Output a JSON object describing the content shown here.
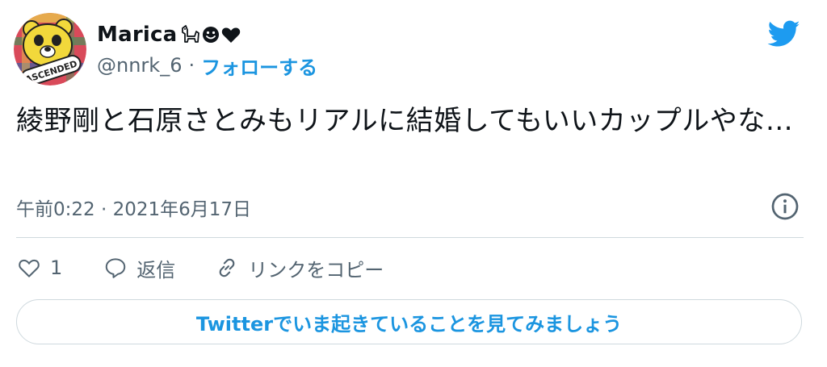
{
  "author": {
    "display_name": "Marica",
    "name_emoji_icons": [
      "dog-emoji-icon",
      "smiley-emoji-icon",
      "black-heart-emoji-icon"
    ],
    "handle": "@nnrk_6",
    "separator": "·",
    "follow_label": "フォローする",
    "avatar_badge_text": "ASCENDED"
  },
  "tweet": {
    "text": "綾野剛と石原さとみもリアルに結婚してもいいカップルやな…",
    "timestamp": "午前0:22 · 2021年6月17日"
  },
  "actions": {
    "like_count": "1",
    "reply_label": "返信",
    "copy_link_label": "リンクをコピー"
  },
  "cta_label": "Twitterでいま起きていることを見てみましょう",
  "colors": {
    "accent": "#1b95e0",
    "twitter_bird": "#1d9bf0",
    "secondary_text": "#536471",
    "border": "#cfd9de"
  }
}
